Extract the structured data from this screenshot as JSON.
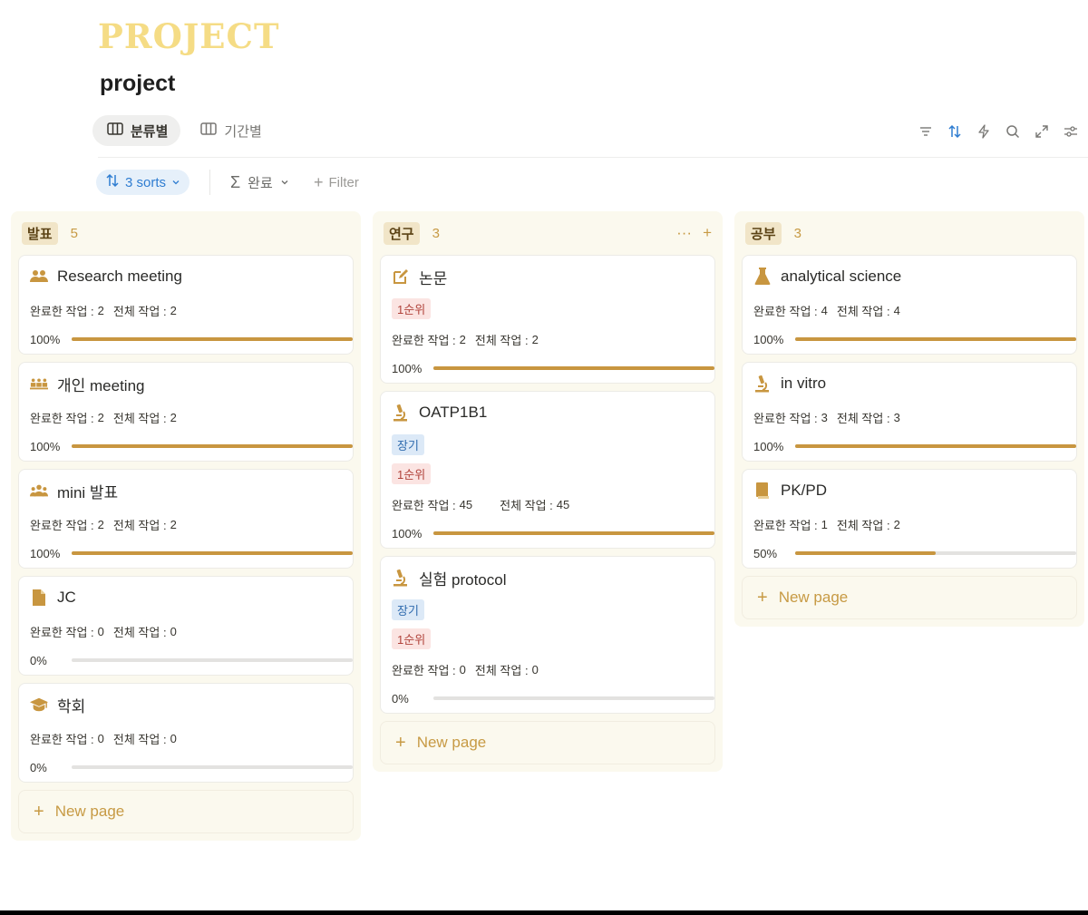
{
  "banner": "PROJECT",
  "title": "project",
  "views": [
    {
      "label": "분류별",
      "active": true
    },
    {
      "label": "기간별",
      "active": false
    }
  ],
  "toolbar": {
    "sorts_label": "3 sorts",
    "aggregate_label": "완료",
    "filter_label": "Filter",
    "icons": [
      "filter-icon",
      "sort-icon",
      "lightning-icon",
      "search-icon",
      "expand-icon",
      "settings-icon"
    ]
  },
  "new_page_label": "New page",
  "stat_labels": {
    "done": "완료한 작업 :",
    "total": "전체 작업 :"
  },
  "columns": [
    {
      "name": "발표",
      "count": "5",
      "cards": [
        {
          "title": "Research meeting",
          "icon": "people-icon",
          "done": "2",
          "total": "2",
          "pct": "100%",
          "progress": 1.0,
          "tags": []
        },
        {
          "title": "개인 meeting",
          "icon": "meeting-icon",
          "done": "2",
          "total": "2",
          "pct": "100%",
          "progress": 1.0,
          "tags": []
        },
        {
          "title": "mini 발표",
          "icon": "group-icon",
          "done": "2",
          "total": "2",
          "pct": "100%",
          "progress": 1.0,
          "tags": []
        },
        {
          "title": "JC",
          "icon": "document-icon",
          "done": "0",
          "total": "0",
          "pct": "0%",
          "progress": 0.0,
          "tags": []
        },
        {
          "title": "학회",
          "icon": "graduation-cap-icon",
          "done": "0",
          "total": "0",
          "pct": "0%",
          "progress": 0.0,
          "tags": []
        }
      ]
    },
    {
      "name": "연구",
      "count": "3",
      "cards": [
        {
          "title": "논문",
          "icon": "edit-icon",
          "done": "2",
          "total": "2",
          "pct": "100%",
          "progress": 1.0,
          "tags": [
            {
              "label": "1순위",
              "color": "red"
            }
          ]
        },
        {
          "title": "OATP1B1",
          "icon": "microscope-icon",
          "done": "45",
          "total": "45",
          "pct": "100%",
          "progress": 1.0,
          "tags": [
            {
              "label": "장기",
              "color": "blue"
            },
            {
              "label": "1순위",
              "color": "red"
            }
          ]
        },
        {
          "title": "실험 protocol",
          "icon": "microscope-icon",
          "done": "0",
          "total": "0",
          "pct": "0%",
          "progress": 0.0,
          "tags": [
            {
              "label": "장기",
              "color": "blue"
            },
            {
              "label": "1순위",
              "color": "red"
            }
          ]
        }
      ]
    },
    {
      "name": "공부",
      "count": "3",
      "cards": [
        {
          "title": "analytical science",
          "icon": "flask-icon",
          "done": "4",
          "total": "4",
          "pct": "100%",
          "progress": 1.0,
          "tags": []
        },
        {
          "title": "in vitro",
          "icon": "microscope-icon",
          "done": "3",
          "total": "3",
          "pct": "100%",
          "progress": 1.0,
          "tags": []
        },
        {
          "title": "PK/PD",
          "icon": "book-icon",
          "done": "1",
          "total": "2",
          "pct": "50%",
          "progress": 0.5,
          "tags": []
        }
      ]
    }
  ],
  "colors": {
    "accent": "#c89640",
    "banner": "#f5dc85",
    "sort_blue": "#2f7dd1"
  }
}
